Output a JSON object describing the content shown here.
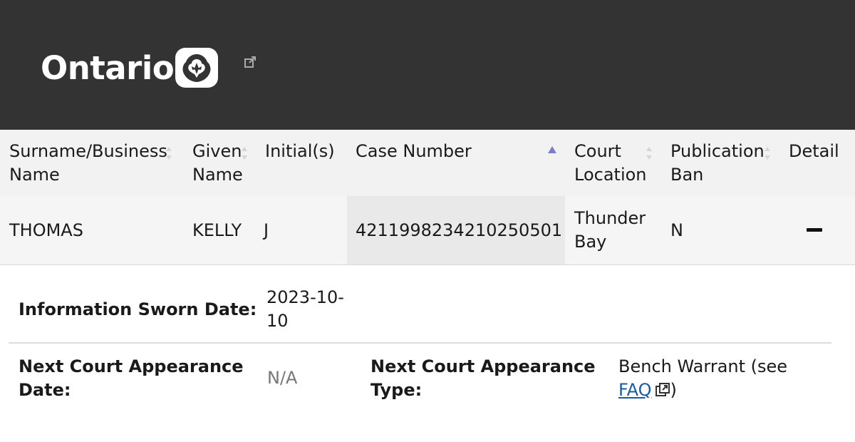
{
  "header": {
    "logo_text": "Ontario",
    "logo_icon": "trillium-icon",
    "external_icon": "external-link-icon",
    "background": "#333333"
  },
  "table": {
    "columns": [
      {
        "label": "Surname/Business Name",
        "line1": "Surname/Business",
        "line2": "Name",
        "sort": "none"
      },
      {
        "label": "Given Name",
        "line1": "Given",
        "line2": "Name",
        "sort": "none"
      },
      {
        "label": "Initial(s)",
        "line1": "Initial(s)",
        "line2": "",
        "sort": "none"
      },
      {
        "label": "Case Number",
        "line1": "Case Number",
        "line2": "",
        "sort": "ascending"
      },
      {
        "label": "Court Location",
        "line1": "Court",
        "line2": "Location",
        "sort": "none"
      },
      {
        "label": "Publication Ban",
        "line1": "Publication",
        "line2": "Ban",
        "sort": "none"
      },
      {
        "label": "Detail",
        "line1": "Detail",
        "line2": "",
        "sort": "none"
      }
    ],
    "rows": [
      {
        "surname": "THOMAS",
        "given_name": "KELLY",
        "initials": "J",
        "case_number": "4211998234210250501",
        "court_location_line1": "Thunder",
        "court_location_line2": "Bay",
        "publication_ban": "N",
        "detail_icon": "collapse-minus-icon"
      }
    ]
  },
  "detail": {
    "info_sworn_label": "Information Sworn Date:",
    "info_sworn_value_line1": "2023-10-",
    "info_sworn_value_line2": "10",
    "next_date_label_line1": "Next Court Appearance",
    "next_date_label_line2": "Date:",
    "next_date_value": "N/A",
    "next_type_label_line1": "Next Court Appearance",
    "next_type_label_line2": "Type:",
    "next_type_value_line1": "Bench Warrant (see",
    "next_type_link": "FAQ",
    "next_type_value_close": ")",
    "link_color": "#1a5aa6"
  }
}
